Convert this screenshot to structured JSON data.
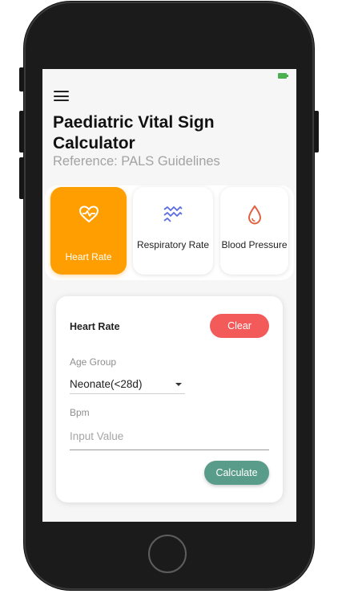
{
  "app": {
    "title": "Paediatric Vital Sign Calculator",
    "subtitle": "Reference: PALS Guidelines"
  },
  "tiles": [
    {
      "label": "Heart Rate",
      "icon": "heart-pulse-icon",
      "active": true
    },
    {
      "label": "Respiratory Rate",
      "icon": "respiratory-wave-icon",
      "active": false
    },
    {
      "label": "Blood Pressure",
      "icon": "blood-drop-icon",
      "active": false
    }
  ],
  "form": {
    "title": "Heart Rate",
    "clear_label": "Clear",
    "age_group_label": "Age Group",
    "age_group_value": "Neonate(<28d)",
    "bpm_label": "Bpm",
    "bpm_placeholder": "Input Value",
    "calculate_label": "Calculate"
  },
  "colors": {
    "accent": "#fe9e01",
    "clear": "#f35a5a",
    "calculate": "#5a9c8a",
    "respiratory_icon": "#5b6ee1",
    "blood_icon": "#e0603f"
  }
}
